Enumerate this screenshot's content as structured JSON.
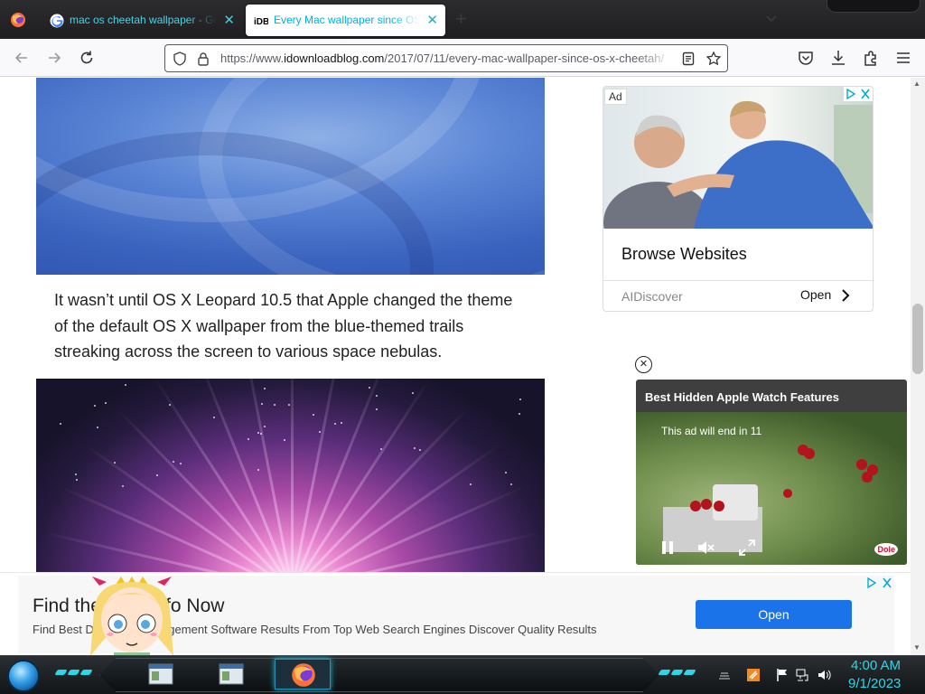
{
  "browser": {
    "tabs": [
      {
        "title": "mac os cheetah wallpaper - Google Search",
        "favicon": "google-g-icon",
        "active": false
      },
      {
        "title": "Every Mac wallpaper since OS X Cheetah",
        "favicon": "idb-favicon",
        "active": true
      }
    ],
    "url_prefix": "https://www.",
    "url_domain": "idownloadblog.com",
    "url_path": "/2017/07/11/every-mac-wallpaper-since-os-x-cheetah/",
    "colors": {
      "tab_text": "#4fd1e0",
      "active_tab_text": "#00b0d8"
    }
  },
  "article": {
    "paragraph": "It wasn’t until OS X Leopard 10.5 that Apple changed the theme of the default OS X wallpaper from the blue-themed trails streaking across the screen to various space nebulas."
  },
  "ads": {
    "side": {
      "badge": "Ad",
      "headline": "Browse Websites",
      "brand": "AIDiscover",
      "cta": "Open"
    },
    "video": {
      "title": "Best Hidden Apple Watch Features",
      "countdown": "This ad will end in 11",
      "brand_logo": "Dole"
    },
    "banner": {
      "title": "Find the Best Info Now",
      "description": "Find Best Database Management Software Results From Top Web Search Engines Discover Quality Results",
      "cta": "Open",
      "cta_color": "#1a73e8"
    }
  },
  "taskbar": {
    "time": "4:00 AM",
    "date": "9/1/2023",
    "accent": "#2ad7e8"
  }
}
